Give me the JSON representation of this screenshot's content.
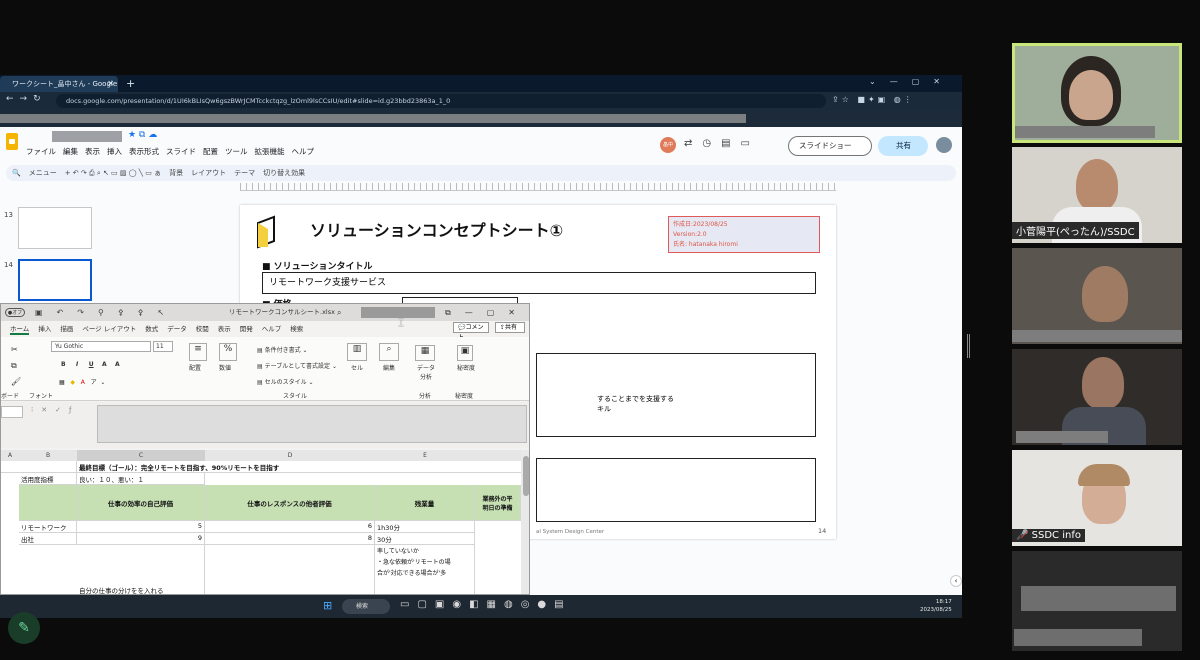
{
  "browser": {
    "tab_title": "ワークシート_畠中さん - Google スライド",
    "url": "docs.google.com/presentation/d/1UI6kBLIsQw6gszBWrJCMTcckctqzg_lzOml9lsCCsIU/edit#slide=id.g23bbd23863a_1_0"
  },
  "slides_app": {
    "menus": [
      "ファイル",
      "編集",
      "表示",
      "挿入",
      "表示形式",
      "スライド",
      "配置",
      "ツール",
      "拡張機能",
      "ヘルプ"
    ],
    "slideshow_label": "スライドショー",
    "share_label": "共有",
    "avatar_initials": "畠中",
    "toolbar_items": [
      "メニュー",
      "背景",
      "レイアウト",
      "テーマ",
      "切り替え効果"
    ],
    "thumb_numbers": [
      "13",
      "14"
    ]
  },
  "slide": {
    "title": "ソリューションコンセプトシート①",
    "meta_date": "作成日:2023/08/25",
    "meta_version": "Version:2.0",
    "meta_author": "氏名: hatanaka hiromi",
    "section_title": "■ ソリューションタイトル",
    "solution_title": "リモートワーク支援サービス",
    "section_price": "■ 価格",
    "text1": "することまでを支援する",
    "text2": "キル",
    "footer": "al System Design Center",
    "page_number": "14"
  },
  "excel": {
    "filename": "リモートワークコンサルシート.xlsx",
    "autosave": "●オフ",
    "tabs": [
      "ホーム",
      "挿入",
      "描画",
      "ページ レイアウト",
      "数式",
      "データ",
      "校閲",
      "表示",
      "開発",
      "ヘルプ",
      "検索"
    ],
    "comment": "コメント",
    "share": "共有",
    "font": "Yu Gothic",
    "font_size": "11",
    "ribbon_labels": [
      "配置",
      "数値",
      "条件付き書式",
      "テーブルとして書式設定",
      "セルのスタイル",
      "スタイル",
      "セル",
      "編集",
      "データ分析",
      "分析",
      "秘密度",
      "秘密度",
      "フォント",
      "ボード"
    ],
    "percent_symbol": "%",
    "columns": [
      "A",
      "B",
      "C",
      "D",
      "E"
    ],
    "goal": "最終目標（ゴール）：完全リモートを目指す、90%リモートを目指す",
    "rating_label": "活用度指標",
    "rating_scale": "良い：１０、悪い：１",
    "headers": [
      "仕事の効率の自己評価",
      "仕事のレスポンスの他者評価",
      "残業量",
      "業務外の平",
      "明日の準備"
    ],
    "rows": [
      {
        "label": "リモートワーク",
        "c": "5",
        "d": "6",
        "e": "1h30分"
      },
      {
        "label": "出社",
        "c": "9",
        "d": "8",
        "e": "30分"
      }
    ],
    "note_e": "率していないか",
    "note_e2": "・急な依頼が'リモートの場",
    "note_e3": "合が'対応できる場合が'多",
    "note_c": "自分の仕事の分けをを入れる"
  },
  "taskbar": {
    "search": "検索",
    "time": "18:17",
    "date": "2023/08/25"
  },
  "participants": [
    {
      "name": ""
    },
    {
      "name": "小菅陽平(ぺったん)/SSDC"
    },
    {
      "name": ""
    },
    {
      "name": ""
    },
    {
      "name": "SSDC info"
    }
  ]
}
